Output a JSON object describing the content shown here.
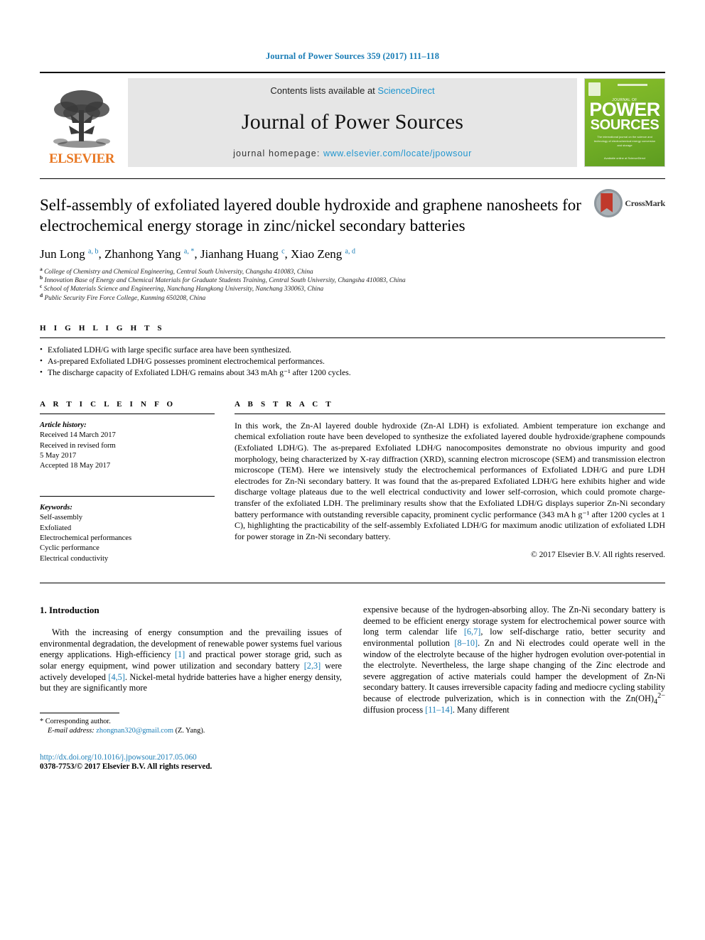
{
  "running_head": "Journal of Power Sources 359 (2017) 111–118",
  "masthead": {
    "publisher": "ELSEVIER",
    "contents_prefix": "Contents lists available at ",
    "contents_link": "ScienceDirect",
    "journal_title": "Journal of Power Sources",
    "homepage_prefix": "journal homepage: ",
    "homepage_link": "www.elsevier.com/locate/jpowsour",
    "cover": {
      "kicker": "JOURNAL OF",
      "line1": "POWER",
      "line2": "SOURCES",
      "subtitle": "The international journal on the science and technology of electrochemical energy conversion and storage",
      "footer": "Available online at\nScienceDirect"
    }
  },
  "article": {
    "title": "Self-assembly of exfoliated layered double hydroxide and graphene nanosheets for electrochemical energy storage in zinc/nickel secondary batteries",
    "crossmark_label": "CrossMark",
    "authors": [
      {
        "name": "Jun Long",
        "marks": "a, b",
        "sep": ", "
      },
      {
        "name": "Zhanhong Yang",
        "marks": "a, *",
        "sep": ", "
      },
      {
        "name": "Jianhang Huang",
        "marks": "c",
        "sep": ", "
      },
      {
        "name": "Xiao Zeng",
        "marks": "a, d",
        "sep": ""
      }
    ],
    "affiliations": [
      {
        "mark": "a",
        "text": "College of Chemistry and Chemical Engineering, Central South University, Changsha 410083, China"
      },
      {
        "mark": "b",
        "text": "Innovation Base of Energy and Chemical Materials for Graduate Students Training, Central South University, Changsha 410083, China"
      },
      {
        "mark": "c",
        "text": "School of Materials Science and Engineering, Nanchang Hangkong University, Nanchang 330063, China"
      },
      {
        "mark": "d",
        "text": "Public Security Fire Force College, Kunming 650208, China"
      }
    ]
  },
  "highlights": {
    "heading": "H I G H L I G H T S",
    "items": [
      "Exfoliated LDH/G with large specific surface area have been synthesized.",
      "As-prepared Exfoliated LDH/G possesses prominent electrochemical performances.",
      "The discharge capacity of Exfoliated LDH/G remains about 343 mAh g⁻¹ after 1200 cycles."
    ]
  },
  "article_info": {
    "heading": "A R T I C L E   I N F O",
    "history_label": "Article history:",
    "history": [
      "Received 14 March 2017",
      "Received in revised form",
      "5 May 2017",
      "Accepted 18 May 2017"
    ],
    "keywords_label": "Keywords:",
    "keywords": [
      "Self-assembly",
      "Exfoliated",
      "Electrochemical performances",
      "Cyclic performance",
      "Electrical conductivity"
    ]
  },
  "abstract": {
    "heading": "A B S T R A C T",
    "text": "In this work, the Zn-Al layered double hydroxide (Zn-Al LDH) is exfoliated. Ambient temperature ion exchange and chemical exfoliation route have been developed to synthesize the exfoliated layered double hydroxide/graphene compounds (Exfoliated LDH/G). The as-prepared Exfoliated LDH/G nanocomposites demonstrate no obvious impurity and good morphology, being characterized by X-ray diffraction (XRD), scanning electron microscope (SEM) and transmission electron microscope (TEM). Here we intensively study the electrochemical performances of Exfoliated LDH/G and pure LDH electrodes for Zn-Ni secondary battery. It was found that the as-prepared Exfoliated LDH/G here exhibits higher and wide discharge voltage plateaus due to the well electrical conductivity and lower self-corrosion, which could promote charge-transfer of the exfoliated LDH. The preliminary results show that the Exfoliated LDH/G displays superior Zn-Ni secondary battery performance with outstanding reversible capacity, prominent cyclic performance (343 mA h g⁻¹ after 1200 cycles at 1 C), highlighting the practicability of the self-assembly Exfoliated LDH/G for maximum anodic utilization of exfoliated LDH for power storage in Zn-Ni secondary battery.",
    "copyright": "© 2017 Elsevier B.V. All rights reserved."
  },
  "introduction": {
    "heading": "1. Introduction",
    "left_paragraph_parts": [
      {
        "t": "With the increasing of energy consumption and the prevailing issues of environmental degradation, the development of renewable power systems fuel various energy applications. High-efficiency "
      },
      {
        "t": "[1]",
        "ref": true
      },
      {
        "t": " and practical power storage grid, such as solar energy equipment, wind power utilization and secondary battery "
      },
      {
        "t": "[2,3]",
        "ref": true
      },
      {
        "t": " were actively developed "
      },
      {
        "t": "[4,5]",
        "ref": true
      },
      {
        "t": ". Nickel-metal hydride batteries have a higher energy density, but they are significantly more"
      }
    ],
    "right_paragraph_parts": [
      {
        "t": "expensive because of the hydrogen-absorbing alloy. The Zn-Ni secondary battery is deemed to be efficient energy storage system for electrochemical power source with long term calendar life "
      },
      {
        "t": "[6,7]",
        "ref": true
      },
      {
        "t": ", low self-discharge ratio, better security and environmental pollution "
      },
      {
        "t": "[8–10]",
        "ref": true
      },
      {
        "t": ". Zn and Ni electrodes could operate well in the window of the electrolyte because of the higher hydrogen evolution over-potential in the electrolyte. Nevertheless, the large shape changing of the Zinc electrode and severe aggregation of active materials could hamper the development of Zn-Ni secondary battery. It causes irreversible capacity fading and mediocre cycling stability because of electrode pulverization, which is in connection with the Zn(OH)"
      },
      {
        "t": "4",
        "sub": true
      },
      {
        "t": "2−",
        "sup": true
      },
      {
        "t": " diffusion process "
      },
      {
        "t": "[11–14]",
        "ref": true
      },
      {
        "t": ". Many different"
      }
    ]
  },
  "footer": {
    "corresponding_author": "Corresponding author.",
    "email_label": "E-mail address:",
    "email": "zhongnan320@gmail.com",
    "email_suffix": "(Z. Yang).",
    "doi": "http://dx.doi.org/10.1016/j.jpowsour.2017.05.060",
    "issn_line": "0378-7753/© 2017 Elsevier B.V. All rights reserved."
  },
  "colors": {
    "link": "#1a7db6",
    "sciencedirect": "#2196cf",
    "elsevier_orange": "#E87722",
    "cover_green": "#76b227",
    "crossmark_red": "#c0392b"
  }
}
